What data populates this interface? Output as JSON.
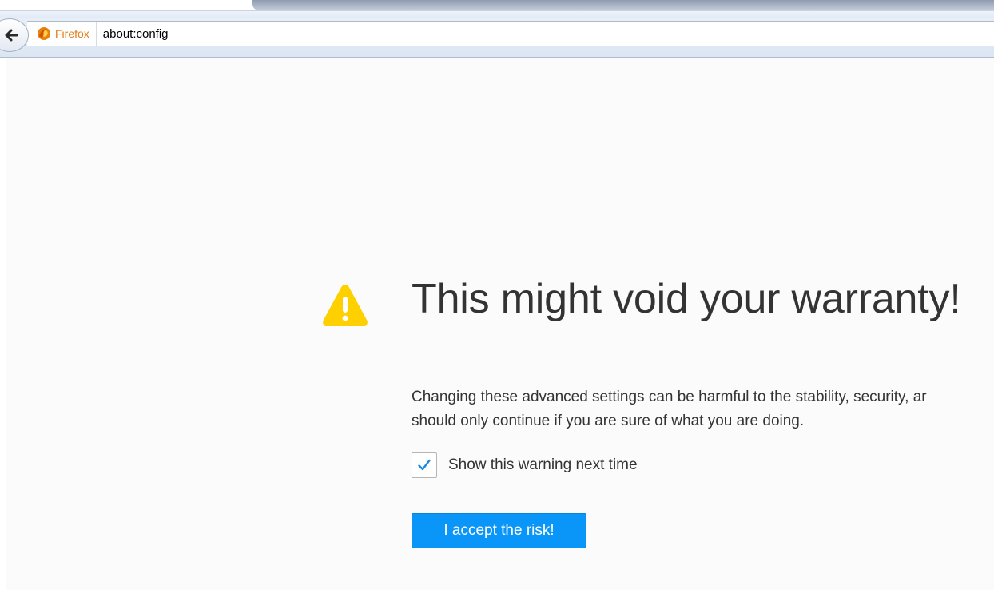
{
  "browser": {
    "identity_label": "Firefox",
    "url": "about:config",
    "accent_color": "#e27b12"
  },
  "icons": {
    "back": "back-arrow-icon",
    "identity": "firefox-logo-icon",
    "warning": "warning-triangle-icon",
    "check": "checkmark-icon"
  },
  "warning_page": {
    "title": "This might void your warranty!",
    "body_line_1": "Changing these advanced settings can be harmful to the stability, security, ar",
    "body_line_2": "should only continue if you are sure of what you are doing.",
    "checkbox_label": "Show this warning next time",
    "checkbox_checked": true,
    "accept_button_label": "I accept the risk!",
    "button_color": "#0996f8",
    "warning_color": "#fed000"
  }
}
